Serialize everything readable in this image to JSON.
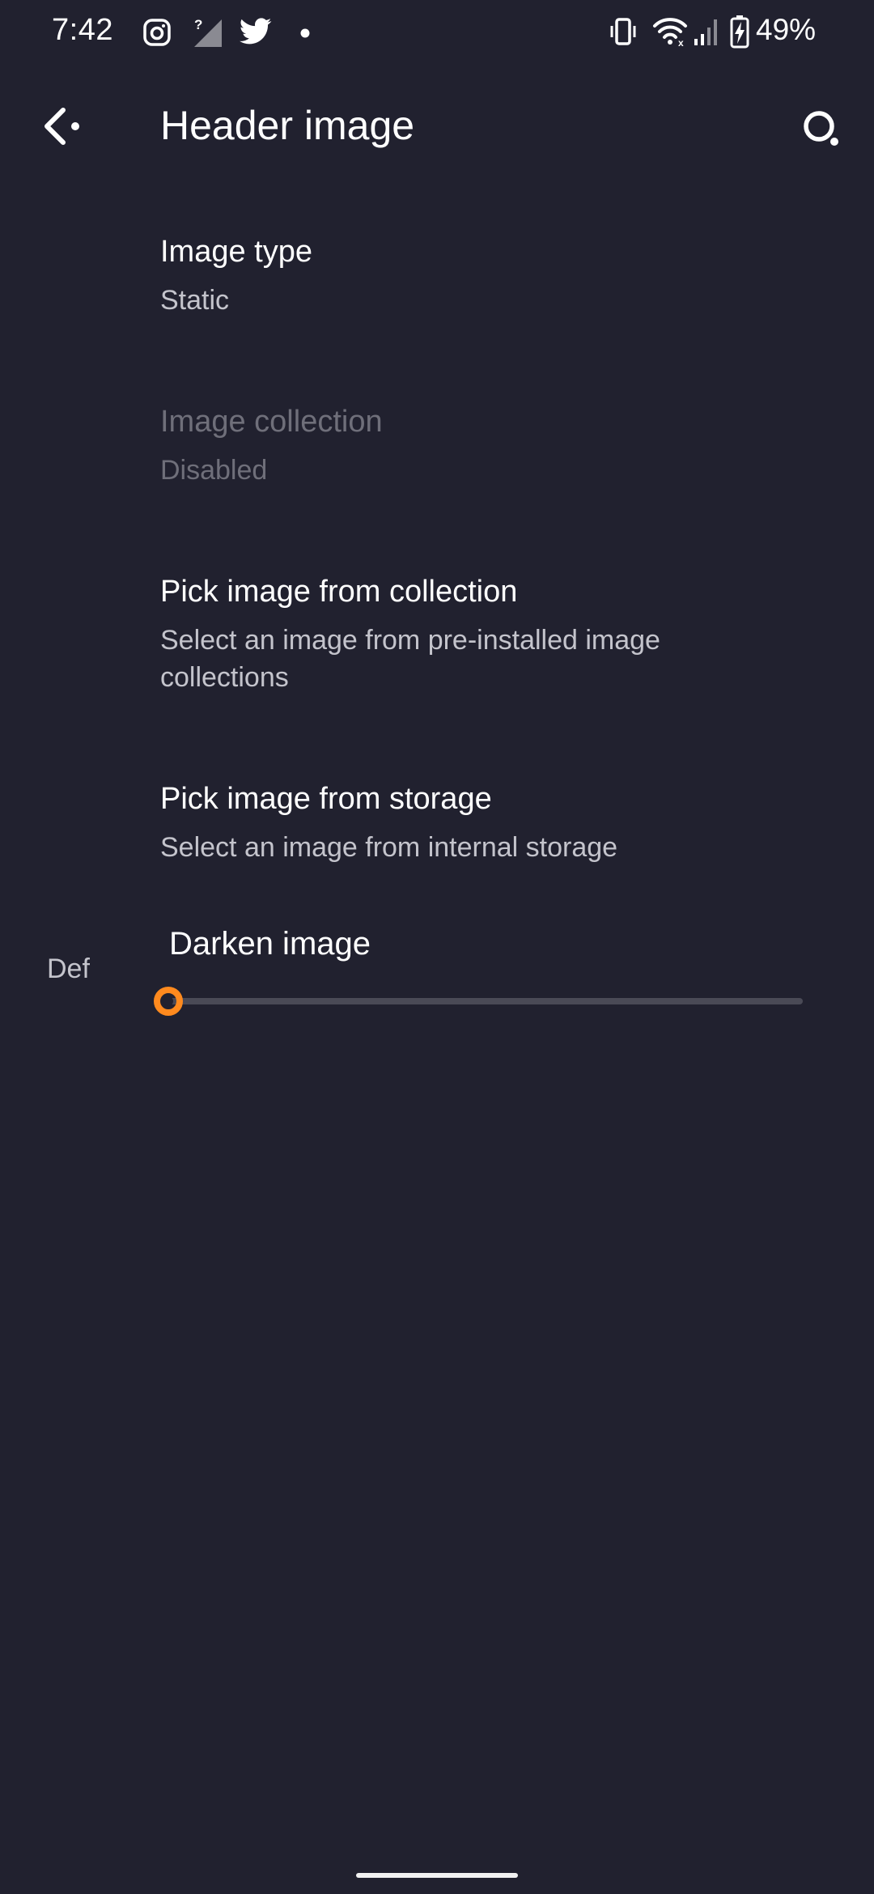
{
  "status_bar": {
    "time": "7:42",
    "battery_percent": "49%",
    "icons_left": [
      "instagram-icon",
      "signal-unknown-icon",
      "twitter-icon",
      "notification-dot-icon"
    ],
    "icons_right": [
      "vibrate-icon",
      "wifi-icon",
      "cell-signal-icon",
      "battery-charging-icon"
    ]
  },
  "app_bar": {
    "title": "Header image",
    "back_icon": "back-arrow-icon",
    "search_icon": "search-icon"
  },
  "preferences": [
    {
      "title": "Image type",
      "summary": "Static",
      "enabled": true
    },
    {
      "title": "Image collection",
      "summary": "Disabled",
      "enabled": false
    },
    {
      "title": "Pick image from collection",
      "summary": "Select an image from pre-installed image collections",
      "enabled": true
    },
    {
      "title": "Pick image from storage",
      "summary": "Select an image from internal storage",
      "enabled": true
    }
  ],
  "darken_slider": {
    "title": "Darken image",
    "side_label": "Def",
    "value_fraction": 0
  },
  "colors": {
    "background": "#21212f",
    "accent": "#ff8a1e",
    "text_primary": "#ffffff",
    "text_secondary": "#c4c4cc",
    "text_disabled": "#6f6f7a"
  }
}
